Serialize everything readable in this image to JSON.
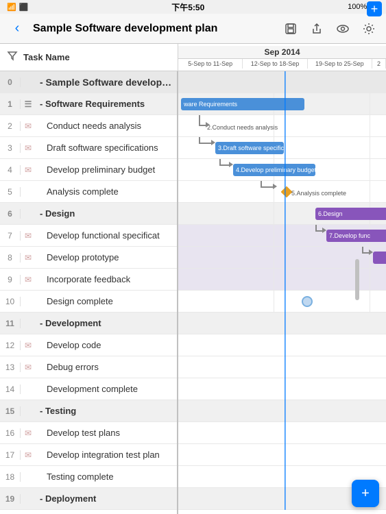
{
  "statusBar": {
    "leftIcons": [
      "🔋",
      "📶"
    ],
    "time": "下午5:50",
    "rightText": "100%"
  },
  "navBar": {
    "title": "Sample Software development plan",
    "backLabel": "‹"
  },
  "navActions": [
    {
      "name": "save-icon",
      "symbol": "⊟"
    },
    {
      "name": "share-icon",
      "symbol": "⬆"
    },
    {
      "name": "eye-icon",
      "symbol": "👁"
    },
    {
      "name": "settings-icon",
      "symbol": "⚙"
    }
  ],
  "toolbar": {
    "filterLabel": "",
    "columnHeader": "Task Name"
  },
  "ganttHeader": {
    "month": "Sep 2014",
    "weeks": [
      "5-Sep to 11-Sep",
      "12-Sep to 18-Sep",
      "19-Sep to 25-Sep",
      "2"
    ]
  },
  "tasks": [
    {
      "id": "0",
      "name": "Sample Software development p",
      "level": "project",
      "icon": ""
    },
    {
      "id": "1",
      "name": "Software Requirements",
      "level": "section",
      "icon": "☰"
    },
    {
      "id": "2",
      "name": "Conduct needs analysis",
      "level": "task",
      "icon": "✉"
    },
    {
      "id": "3",
      "name": "Draft software specifications",
      "level": "task",
      "icon": "✉"
    },
    {
      "id": "4",
      "name": "Develop preliminary budget",
      "level": "task",
      "icon": "✉"
    },
    {
      "id": "5",
      "name": "Analysis complete",
      "level": "task",
      "icon": ""
    },
    {
      "id": "6",
      "name": "Design",
      "level": "section",
      "icon": ""
    },
    {
      "id": "7",
      "name": "Develop functional specificat",
      "level": "task",
      "icon": "✉"
    },
    {
      "id": "8",
      "name": "Develop prototype",
      "level": "task",
      "icon": "✉"
    },
    {
      "id": "9",
      "name": "Incorporate feedback",
      "level": "task",
      "icon": "✉"
    },
    {
      "id": "10",
      "name": "Design complete",
      "level": "task",
      "icon": ""
    },
    {
      "id": "11",
      "name": "Development",
      "level": "section",
      "icon": ""
    },
    {
      "id": "12",
      "name": "Develop code",
      "level": "task",
      "icon": "✉"
    },
    {
      "id": "13",
      "name": "Debug errors",
      "level": "task",
      "icon": "✉"
    },
    {
      "id": "14",
      "name": "Development complete",
      "level": "task",
      "icon": ""
    },
    {
      "id": "15",
      "name": "Testing",
      "level": "section",
      "icon": ""
    },
    {
      "id": "16",
      "name": "Develop test plans",
      "level": "task",
      "icon": "✉"
    },
    {
      "id": "17",
      "name": "Develop integration test plan",
      "level": "task",
      "icon": "✉"
    },
    {
      "id": "18",
      "name": "Testing complete",
      "level": "task",
      "icon": ""
    },
    {
      "id": "19",
      "name": "Deployment",
      "level": "section",
      "icon": ""
    }
  ],
  "plusLabel": "+",
  "fabLabel": "+"
}
